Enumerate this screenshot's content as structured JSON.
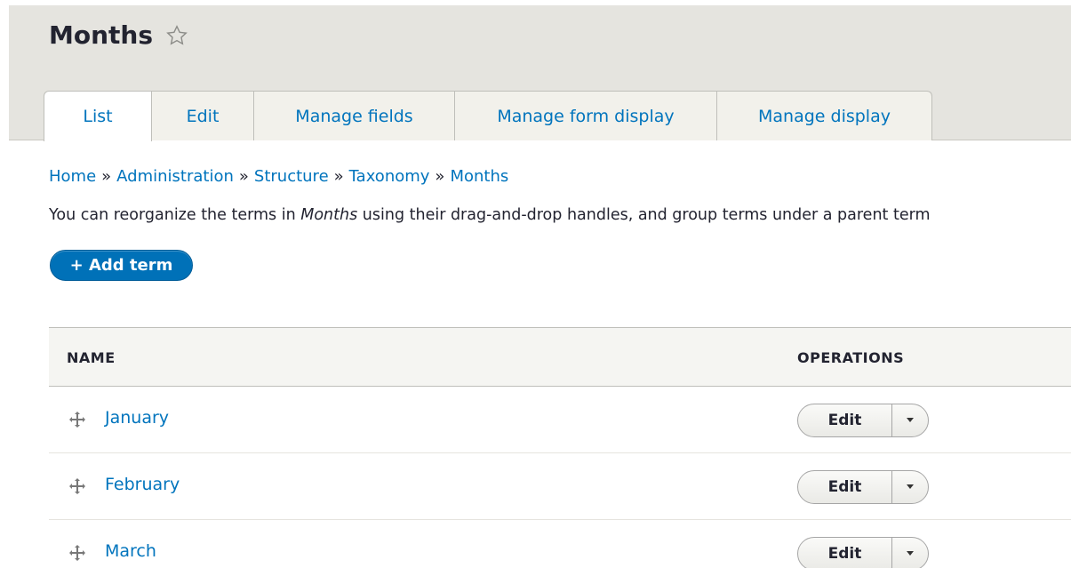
{
  "header": {
    "title": "Months",
    "tabs": [
      {
        "label": "List",
        "active": true
      },
      {
        "label": "Edit",
        "active": false
      },
      {
        "label": "Manage fields",
        "active": false
      },
      {
        "label": "Manage form display",
        "active": false
      },
      {
        "label": "Manage display",
        "active": false
      }
    ]
  },
  "breadcrumb": {
    "items": [
      "Home",
      "Administration",
      "Structure",
      "Taxonomy",
      "Months"
    ],
    "separator": "»"
  },
  "help": {
    "before": "You can reorganize the terms in ",
    "emphasis": "Months",
    "after": " using their drag-and-drop handles, and group terms under a parent term"
  },
  "actions": {
    "add_term_label": "+ Add term"
  },
  "table": {
    "columns": [
      "NAME",
      "OPERATIONS"
    ],
    "rows": [
      {
        "name": "January",
        "operation": "Edit"
      },
      {
        "name": "February",
        "operation": "Edit"
      },
      {
        "name": "March",
        "operation": "Edit"
      }
    ]
  },
  "colors": {
    "link": "#0074bd",
    "primary_button": "#0071b8",
    "header_bg": "#e5e4df"
  }
}
